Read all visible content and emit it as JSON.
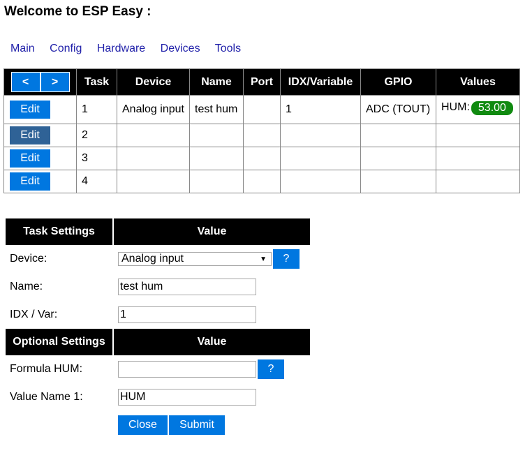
{
  "page": {
    "title": "Welcome to ESP Easy :"
  },
  "nav": [
    "Main",
    "Config",
    "Hardware",
    "Devices",
    "Tools"
  ],
  "task_table": {
    "prev_label": "<",
    "next_label": ">",
    "headers": [
      "Task",
      "Device",
      "Name",
      "Port",
      "IDX/Variable",
      "GPIO",
      "Values"
    ],
    "edit_label": "Edit",
    "rows": [
      {
        "task": "1",
        "device": "Analog input",
        "name": "test hum",
        "port": "",
        "idx": "1",
        "gpio": "ADC (TOUT)",
        "value_label": "HUM:",
        "value": "53.00"
      },
      {
        "task": "2",
        "device": "",
        "name": "",
        "port": "",
        "idx": "",
        "gpio": "",
        "value_label": "",
        "value": ""
      },
      {
        "task": "3",
        "device": "",
        "name": "",
        "port": "",
        "idx": "",
        "gpio": "",
        "value_label": "",
        "value": ""
      },
      {
        "task": "4",
        "device": "",
        "name": "",
        "port": "",
        "idx": "",
        "gpio": "",
        "value_label": "",
        "value": ""
      }
    ]
  },
  "settings": {
    "task_header": "Task Settings",
    "value_header": "Value",
    "device_label": "Device:",
    "device_value": "Analog input",
    "help_label": "?",
    "name_label": "Name:",
    "name_value": "test hum",
    "idx_label": "IDX / Var:",
    "idx_value": "1",
    "optional_header": "Optional Settings",
    "formula_label": "Formula HUM:",
    "formula_value": "",
    "valuename_label": "Value Name 1:",
    "valuename_value": "HUM",
    "close_label": "Close",
    "submit_label": "Submit"
  }
}
